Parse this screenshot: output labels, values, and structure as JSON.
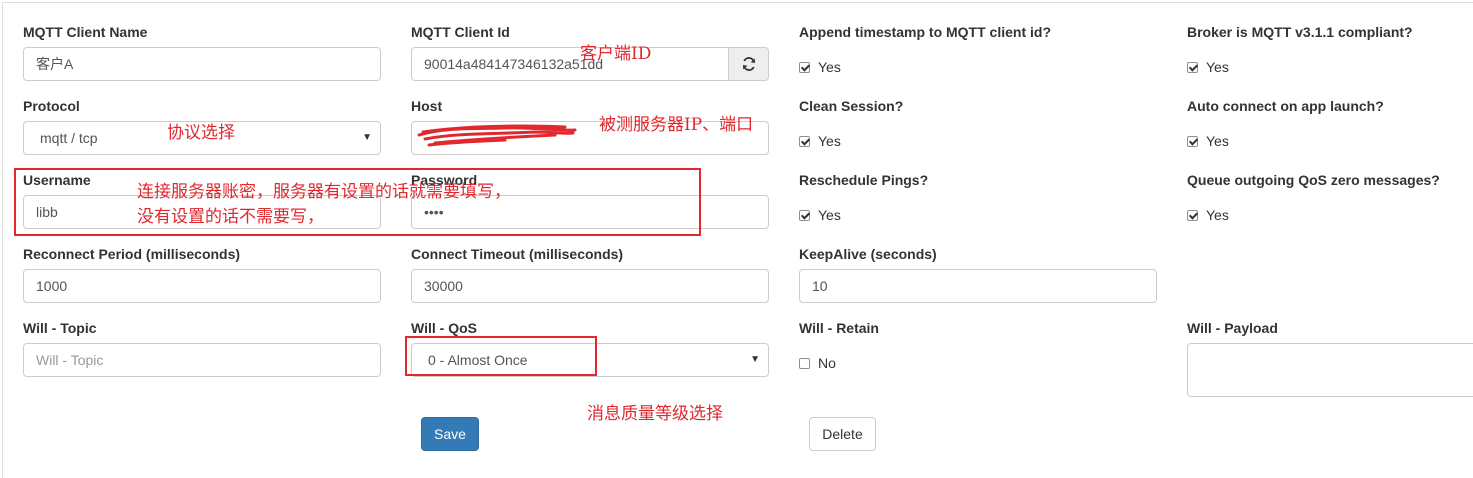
{
  "fields": {
    "client_name": {
      "label": "MQTT Client Name",
      "value": "客户A"
    },
    "client_id": {
      "label": "MQTT Client Id",
      "value": "90014a484147346132a51dd"
    },
    "append_timestamp": {
      "label": "Append timestamp to MQTT client id?",
      "checked": true,
      "option": "Yes"
    },
    "broker_compliant": {
      "label": "Broker is MQTT v3.1.1 compliant?",
      "checked": true,
      "option": "Yes"
    },
    "protocol": {
      "label": "Protocol",
      "value": "mqtt / tcp"
    },
    "host": {
      "label": "Host",
      "value": ""
    },
    "clean_session": {
      "label": "Clean Session?",
      "checked": true,
      "option": "Yes"
    },
    "auto_connect": {
      "label": "Auto connect on app launch?",
      "checked": true,
      "option": "Yes"
    },
    "username": {
      "label": "Username",
      "value": "libb"
    },
    "password": {
      "label": "Password",
      "value": "••••"
    },
    "reschedule_pings": {
      "label": "Reschedule Pings?",
      "checked": true,
      "option": "Yes"
    },
    "queue_qos_zero": {
      "label": "Queue outgoing QoS zero messages?",
      "checked": true,
      "option": "Yes"
    },
    "reconnect_period": {
      "label": "Reconnect Period (milliseconds)",
      "value": "1000"
    },
    "connect_timeout": {
      "label": "Connect Timeout (milliseconds)",
      "value": "30000"
    },
    "keepalive": {
      "label": "KeepAlive (seconds)",
      "value": "10"
    },
    "will_topic": {
      "label": "Will - Topic",
      "placeholder": "Will - Topic"
    },
    "will_qos": {
      "label": "Will - QoS",
      "value": "0 - Almost Once"
    },
    "will_retain": {
      "label": "Will - Retain",
      "checked": false,
      "option": "No"
    },
    "will_payload": {
      "label": "Will - Payload",
      "value": ""
    }
  },
  "buttons": {
    "save": "Save",
    "delete": "Delete"
  },
  "annotations": {
    "client_id_note": "客户端ID",
    "protocol_note": "协议选择",
    "host_note": "被测服务器IP、端口",
    "account_note_line1": "连接服务器账密，服务器有设置的话就需要填写，",
    "account_note_line2": "没有设置的话不需要写，",
    "qos_note": "消息质量等级选择"
  },
  "colors": {
    "annotation": "#e0282e",
    "primary": "#337ab7"
  }
}
